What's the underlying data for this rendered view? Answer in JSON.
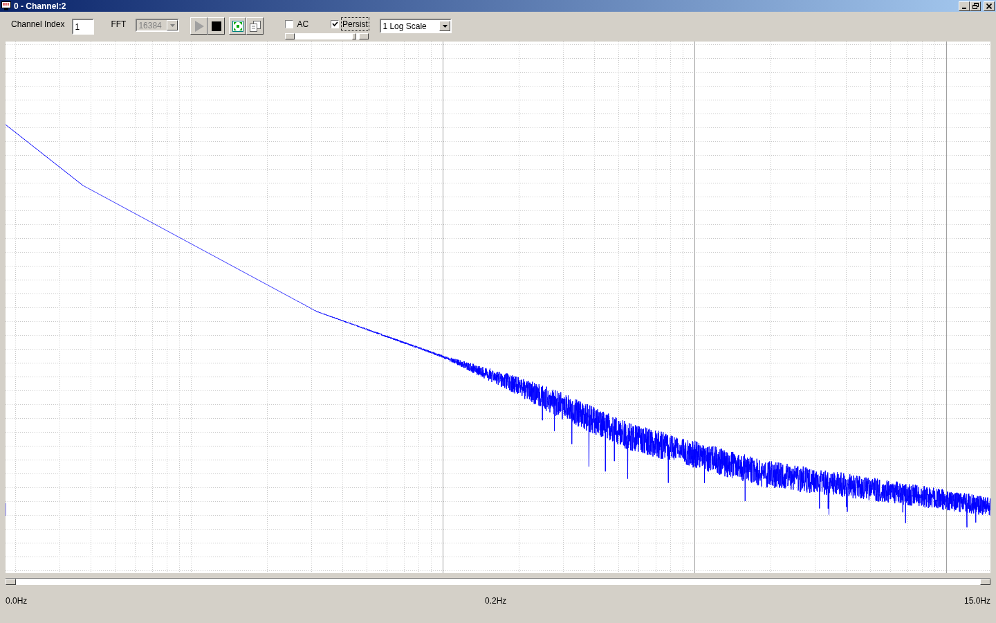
{
  "window": {
    "title": "0 - Channel:2"
  },
  "toolbar": {
    "channel_index": {
      "label": "Channel Index",
      "value": "1"
    },
    "fft": {
      "label": "FFT",
      "value": "16384",
      "disabled": true
    },
    "play": {
      "disabled": true
    },
    "ac": {
      "label": "AC",
      "checked": false
    },
    "persist": {
      "label": "Persist",
      "checked": true
    },
    "slider": {
      "level": 0.95
    },
    "scale": {
      "value": "1 Log Scale"
    }
  },
  "plot": {
    "x_labels": [
      "0.0Hz",
      "0.2Hz",
      "15.0Hz"
    ]
  }
}
